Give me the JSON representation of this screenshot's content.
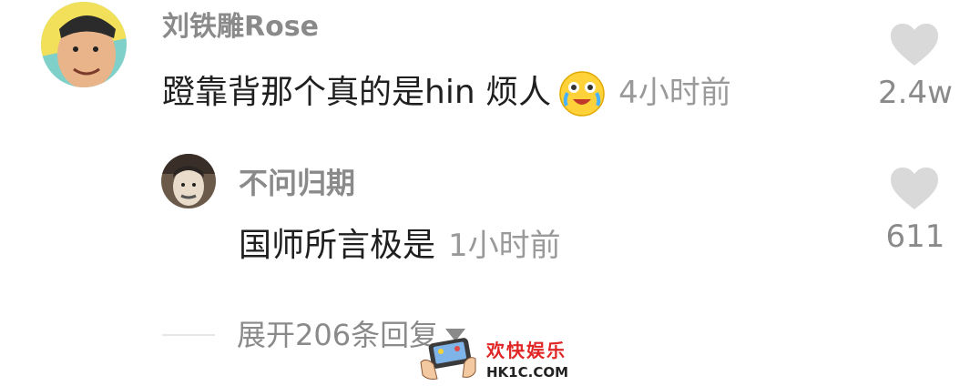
{
  "comments": [
    {
      "username": "刘铁雕Rose",
      "text": "蹬靠背那个真的是hin 烦人",
      "emoji": "laughing-tears-emoji",
      "time": "4小时前",
      "likes": "2.4w"
    }
  ],
  "reply": {
    "username": "不问归期",
    "text": "国师所言极是",
    "time": "1小时前",
    "likes": "611"
  },
  "expand": {
    "label": "展开206条回复"
  },
  "watermark": {
    "cn": "欢快娱乐",
    "en": "HK1C.COM"
  },
  "colors": {
    "username": "#8a8a8a",
    "text": "#1f1f1f",
    "timestamp": "#9a9a9a",
    "heart": "#d9d9d9",
    "watermark_red": "#e02626"
  }
}
